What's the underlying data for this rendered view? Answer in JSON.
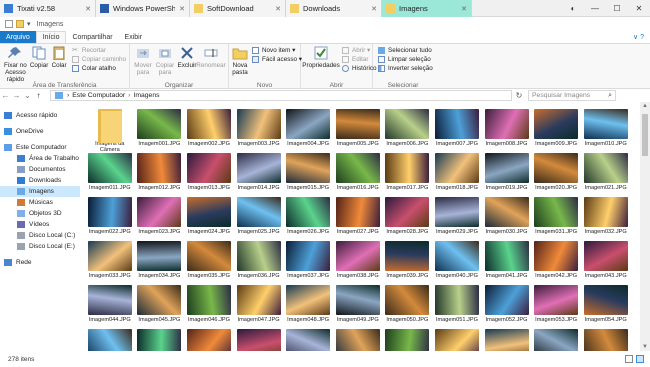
{
  "tabs": [
    {
      "label": "Tixati v2.58",
      "icon": "tixati-icon",
      "color": "#3a7bd5"
    },
    {
      "label": "Windows PowerSh...",
      "icon": "powershell-icon",
      "color": "#2b5aa8"
    },
    {
      "label": "SoftDownload",
      "icon": "download-folder-icon",
      "color": "#f2cf63"
    },
    {
      "label": "Downloads",
      "icon": "folder-icon",
      "color": "#f2cf63"
    },
    {
      "label": "Imagens",
      "icon": "folder-icon",
      "color": "#f2cf63",
      "active": true
    }
  ],
  "window_title": "Imagens",
  "ribbon_tabs": [
    "Arquivo",
    "Início",
    "Compartilhar",
    "Exibir"
  ],
  "ribbon": {
    "clipboard": {
      "pin": "Fixar no Acesso rápido",
      "copy": "Copiar",
      "paste": "Colar",
      "cut": "Recortar",
      "copy_path": "Copiar caminho",
      "paste_shortcut": "Colar atalho",
      "label": "Área de Transferência"
    },
    "organize": {
      "move": "Mover para",
      "copyto": "Copiar para",
      "delete": "Excluir",
      "rename": "Renomear",
      "label": "Organizar"
    },
    "new": {
      "new_folder": "Nova pasta",
      "new_item": "Novo item",
      "easy_access": "Fácil acesso",
      "label": "Novo"
    },
    "open": {
      "properties": "Propriedades",
      "open": "Abrir",
      "edit": "Editar",
      "history": "Histórico",
      "label": "Abrir"
    },
    "select": {
      "select_all": "Selecionar tudo",
      "select_none": "Limpar seleção",
      "invert": "Inverter seleção",
      "label": "Selecionar"
    }
  },
  "address": {
    "path": [
      "Este Computador",
      "Imagens"
    ],
    "search_placeholder": "Pesquisar Imagens"
  },
  "nav_pane": [
    {
      "label": "Acesso rápido",
      "icon": "star-icon",
      "level": 1
    },
    {
      "label": "OneDrive",
      "icon": "cloud-icon",
      "level": 1
    },
    {
      "label": "Este Computador",
      "icon": "computer-icon",
      "level": 1
    },
    {
      "label": "Área de Trabalho",
      "icon": "desktop-icon",
      "level": 2
    },
    {
      "label": "Documentos",
      "icon": "documents-icon",
      "level": 2
    },
    {
      "label": "Downloads",
      "icon": "downloads-icon",
      "level": 2
    },
    {
      "label": "Imagens",
      "icon": "pictures-icon",
      "level": 2,
      "selected": true
    },
    {
      "label": "Músicas",
      "icon": "music-icon",
      "level": 2
    },
    {
      "label": "Objetos 3D",
      "icon": "3d-objects-icon",
      "level": 2
    },
    {
      "label": "Vídeos",
      "icon": "videos-icon",
      "level": 2
    },
    {
      "label": "Disco Local (C:)",
      "icon": "drive-icon",
      "level": 2
    },
    {
      "label": "Disco Local (E:)",
      "icon": "drive-icon",
      "level": 2
    },
    {
      "label": "Rede",
      "icon": "network-icon",
      "level": 1
    }
  ],
  "folder_item": "Imagens da Câmera",
  "file_prefix": "Imagem",
  "file_ext": ".JPG",
  "file_count_visible": 65,
  "status": "278 itens",
  "thumb_palette": [
    [
      "#1b2a3a",
      "#e0a35a"
    ],
    [
      "#2a1a3d",
      "#c94f6d"
    ],
    [
      "#0c2b2a",
      "#5ad38c"
    ],
    [
      "#c96d2c",
      "#2a3b5e"
    ],
    [
      "#0b1c36",
      "#4da0d8"
    ],
    [
      "#3a2a1a",
      "#d38a3c"
    ],
    [
      "#163a54",
      "#f2c17b"
    ],
    [
      "#1d3d1d",
      "#78b84a"
    ],
    [
      "#2b2b44",
      "#a7b4d8"
    ],
    [
      "#542218",
      "#f08a3a"
    ],
    [
      "#0f2f4f",
      "#6ec0f0"
    ],
    [
      "#3b1d3b",
      "#e06fb5"
    ],
    [
      "#22362a",
      "#b8d08a"
    ],
    [
      "#101418",
      "#8ba6c2"
    ],
    [
      "#5a3a14",
      "#ffcf6b"
    ]
  ]
}
